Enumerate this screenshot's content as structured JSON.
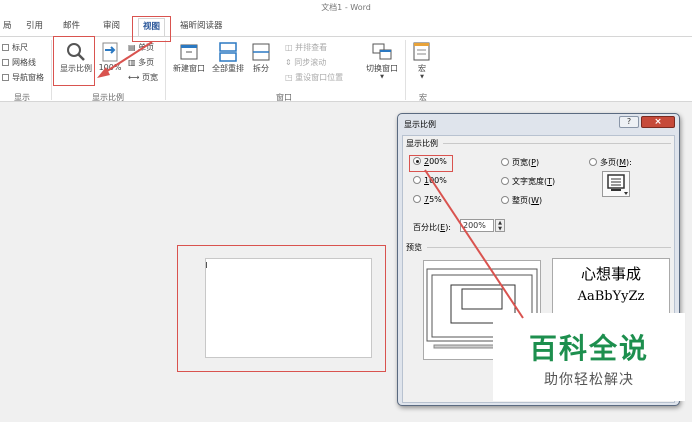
{
  "window": {
    "title": "文档1 - Word"
  },
  "tabs": [
    {
      "label": "局"
    },
    {
      "label": "引用"
    },
    {
      "label": "邮件"
    },
    {
      "label": "审阅"
    },
    {
      "label": "视图"
    },
    {
      "label": "福昕阅读器"
    }
  ],
  "ribbon": {
    "show_group": {
      "label": "显示",
      "items": [
        "标尺",
        "网格线",
        "导航窗格"
      ]
    },
    "zoom_group": {
      "label": "显示比例",
      "zoom_button": "显示比例",
      "hundred_button": "100%",
      "one_page": "单页",
      "multi_page": "多页",
      "page_width": "页宽"
    },
    "window_group": {
      "label": "窗口",
      "new_window": "新建窗口",
      "arrange_all": "全部重排",
      "split": "拆分",
      "side_by_side": "并排查看",
      "sync_scroll": "同步滚动",
      "reset_position": "重设窗口位置",
      "switch_windows": "切换窗口"
    },
    "macro_group": {
      "label": "宏",
      "macros": "宏"
    }
  },
  "dialog": {
    "title": "显示比例",
    "help": "?",
    "close": "×",
    "zoom_section": "显示比例",
    "options": {
      "p200": {
        "pre": "",
        "key": "2",
        "post": "00%",
        "checked": true
      },
      "p100": {
        "pre": "",
        "key": "1",
        "post": "00%",
        "checked": false
      },
      "p75": {
        "pre": "",
        "key": "7",
        "post": "5%",
        "checked": false
      },
      "page_width": {
        "pre": "页宽(",
        "key": "P",
        "post": ")",
        "checked": false
      },
      "text_width": {
        "pre": "文字宽度(",
        "key": "T",
        "post": ")",
        "checked": false
      },
      "whole_page": {
        "pre": "整页(",
        "key": "W",
        "post": ")",
        "checked": false
      },
      "many_pages": {
        "pre": "多页(",
        "key": "M",
        "post": "):",
        "checked": false
      }
    },
    "percent_label_pre": "百分比(",
    "percent_label_key": "E",
    "percent_label_post": "):",
    "percent_value": "200%",
    "preview_section": "预览",
    "preview_text_cn": "心想事成",
    "preview_text_en": "AaBbYyZz"
  },
  "watermark": {
    "main": "百科全说",
    "sub": "助你轻松解决"
  },
  "colors": {
    "accent": "#2b579a",
    "annotation_red": "#d9534f",
    "watermark_green": "#1d8f4e"
  }
}
